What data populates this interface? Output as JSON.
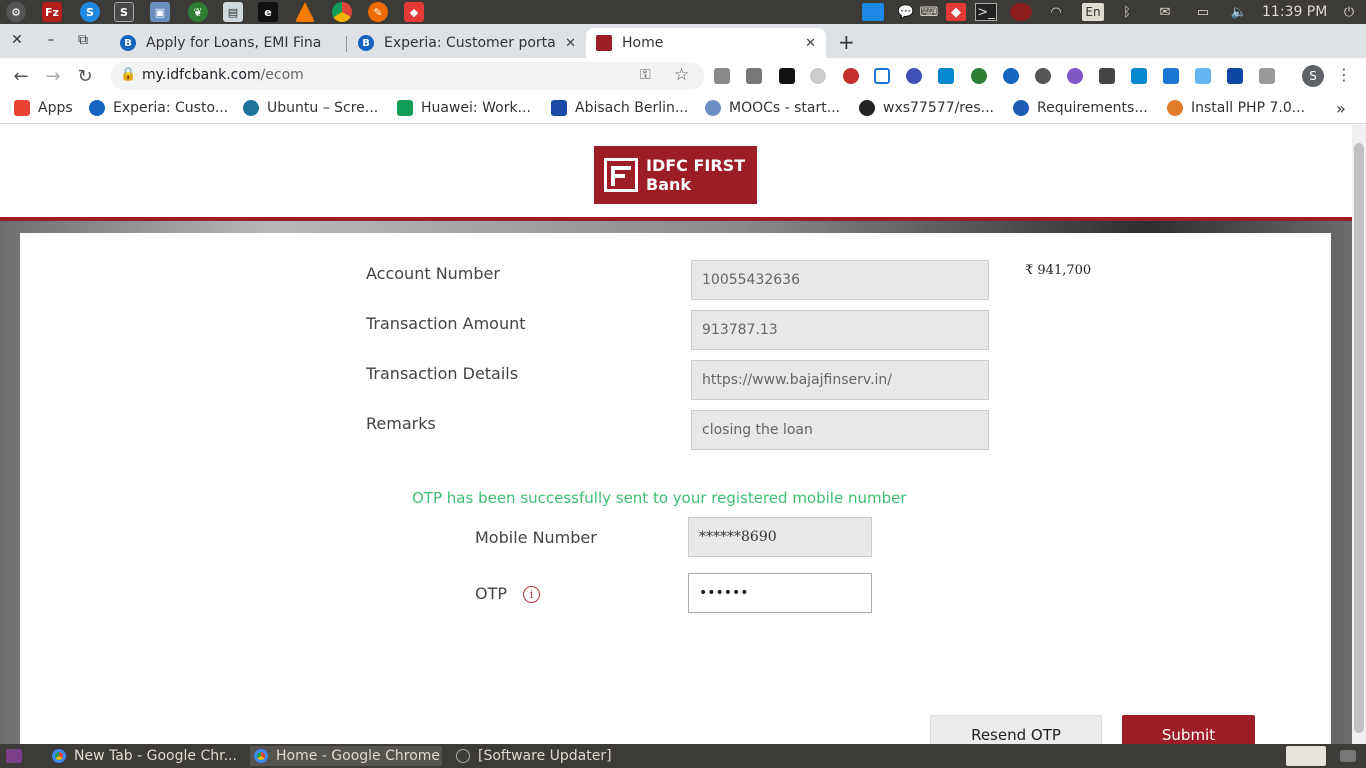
{
  "os_bar": {
    "launcher_icons": [
      "settings-icon",
      "filezilla-icon",
      "skype-icon",
      "sublime-icon",
      "box-icon",
      "mongodb-icon",
      "document-icon",
      "eboard-icon",
      "vlc-icon",
      "chrome-icon",
      "postman-icon",
      "anydesk-icon"
    ],
    "keyboard_layout": "En",
    "clock": "11:39 PM"
  },
  "tabs": [
    {
      "title": "Apply for Loans, EMI Fina",
      "color": "#1565c0"
    },
    {
      "title": "Experia: Customer portal",
      "color": "#1565c0"
    },
    {
      "title": "Home",
      "color": "#9c1d26"
    }
  ],
  "address_bar": {
    "host": "my.idfcbank.com",
    "path": "/ecom"
  },
  "profile_initial": "S",
  "bookmarks": [
    {
      "label": "Apps",
      "color": "#e94235"
    },
    {
      "label": "Experia: Custo...",
      "color": "#1565c0"
    },
    {
      "label": "Ubuntu – Scre...",
      "color": "#21759b"
    },
    {
      "label": "Huawei: Work...",
      "color": "#0f9d58"
    },
    {
      "label": "Abisach Berlin...",
      "color": "#1a4aa8"
    },
    {
      "label": "MOOCs - start...",
      "color": "#6b8fc4"
    },
    {
      "label": "wxs77577/res...",
      "color": "#222222"
    },
    {
      "label": "Requirements...",
      "color": "#1e5bb8"
    },
    {
      "label": "Install PHP 7.0...",
      "color": "#e07b2a"
    }
  ],
  "bank": {
    "logo_line1": "IDFC FIRST",
    "logo_line2": "Bank",
    "brand_color": "#9c1d26"
  },
  "form": {
    "account_number_label": "Account Number",
    "account_number_value": "10055432636",
    "balance": "₹ 941,700",
    "transaction_amount_label": "Transaction Amount",
    "transaction_amount_value": "913787.13",
    "transaction_details_label": "Transaction Details",
    "transaction_details_value": "https://www.bajajfinserv.in/",
    "remarks_label": "Remarks",
    "remarks_value": "closing the loan",
    "otp_message": "OTP has been successfully sent to your registered mobile number",
    "mobile_label": "Mobile Number",
    "mobile_value": "******8690",
    "otp_label": "OTP",
    "otp_info_icon": "i",
    "otp_value": "••••••",
    "resend_label": "Resend OTP",
    "submit_label": "Submit"
  },
  "taskbar": [
    {
      "label": "New Tab - Google Chr..."
    },
    {
      "label": "Home - Google Chrome"
    },
    {
      "label": "[Software Updater]"
    }
  ]
}
